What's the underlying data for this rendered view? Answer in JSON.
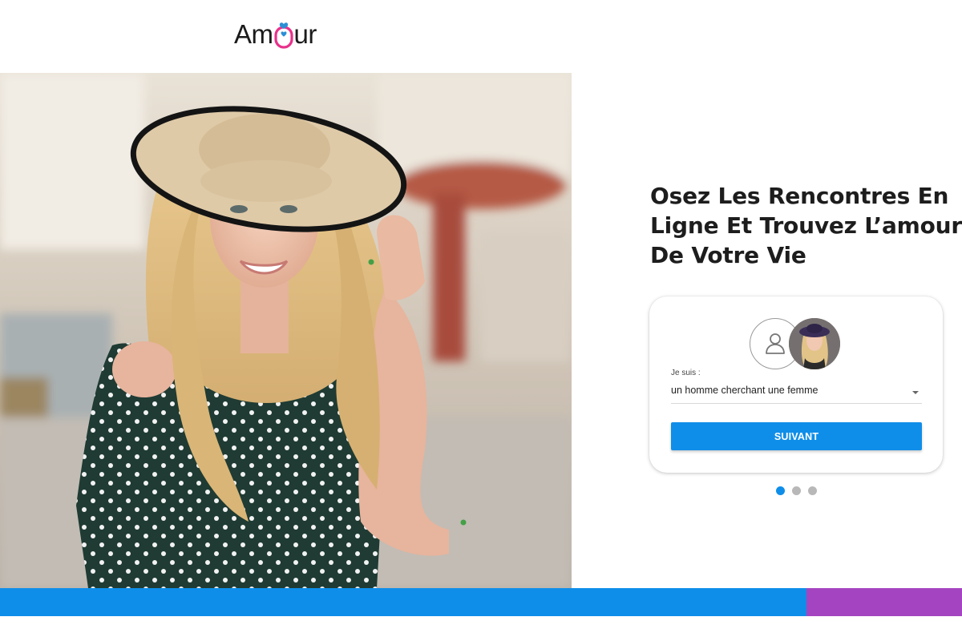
{
  "brand": {
    "logo_text_start": "Am",
    "logo_text_end": "ur",
    "colors": {
      "logo_pink": "#e8318b",
      "logo_blue": "#2a8fd6"
    }
  },
  "hero": {
    "image": "smiling-woman-in-hat-photo"
  },
  "headline": {
    "lines": [
      "Osez Les Rencontres En",
      "Ligne Et Trouvez L’amour",
      "De Votre Vie"
    ]
  },
  "form": {
    "user_icon": "user-icon",
    "profile_photo": "woman-profile-photo",
    "label": "Je suis :",
    "select_value": "un homme cherchant une femme",
    "submit_label": "SUIVANT"
  },
  "pagination": {
    "total": 3,
    "active_index": 0
  },
  "colors": {
    "primary": "#0f8ee9",
    "accent": "#a444c0",
    "text": "#1d1d1d",
    "background": "#ffffff"
  }
}
